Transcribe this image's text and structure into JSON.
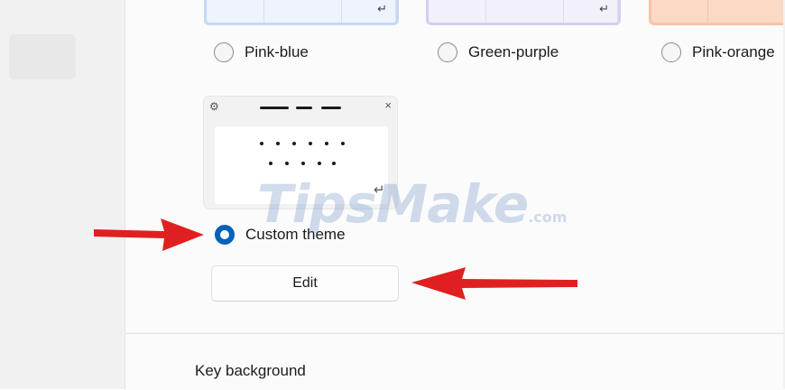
{
  "themes": {
    "options": [
      {
        "label": "Pink-blue",
        "selected": false
      },
      {
        "label": "Green-purple",
        "selected": false
      },
      {
        "label": "Pink-orange",
        "selected": false
      },
      {
        "label": "Custom theme",
        "selected": true
      }
    ]
  },
  "custom_preview": {
    "gear_icon": "⚙",
    "close_icon": "×",
    "enter_icon": "↵"
  },
  "edit_button": {
    "label": "Edit"
  },
  "key_background": {
    "label": "Key background"
  },
  "watermark": {
    "brand": "TipsMake",
    "suffix": ".com"
  },
  "colors": {
    "accent": "#0063b8",
    "arrow": "#e02020"
  }
}
